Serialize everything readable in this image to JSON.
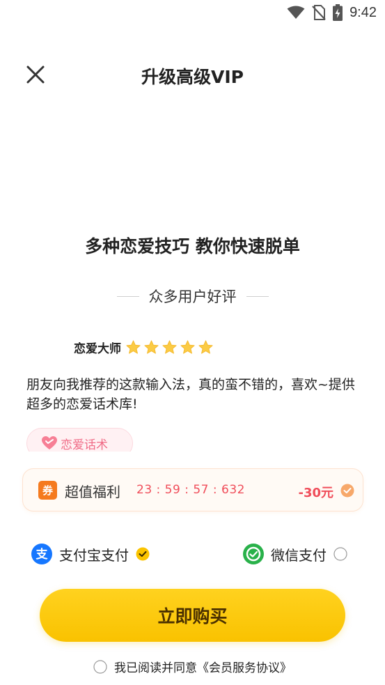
{
  "status_bar": {
    "time": "9:42"
  },
  "header": {
    "title": "升级高级VIP"
  },
  "headline": "多种恋爱技巧 教你快速脱单",
  "reviews": {
    "heading": "众多用户好评",
    "reviewer": "恋爱大师",
    "rating": 5,
    "text": "朋友向我推荐的这款输入法，真的蛮不错的，喜欢~提供超多的恋爱话术库!",
    "tag": "恋爱话术"
  },
  "offer": {
    "badge": "券",
    "title": "超值福利",
    "timer": "23 : 59 : 57 : 632",
    "discount": "-30元"
  },
  "payment": {
    "alipay_label": "支付宝支付",
    "wechat_label": "微信支付",
    "selected": "alipay"
  },
  "buy_button": "立即购买",
  "agreement": {
    "prefix": "我已阅读并同意",
    "link": "《会员服务协议》"
  },
  "colors": {
    "accent": "#f9c200",
    "discount": "#f04d5a",
    "tag": "#f06b86"
  }
}
